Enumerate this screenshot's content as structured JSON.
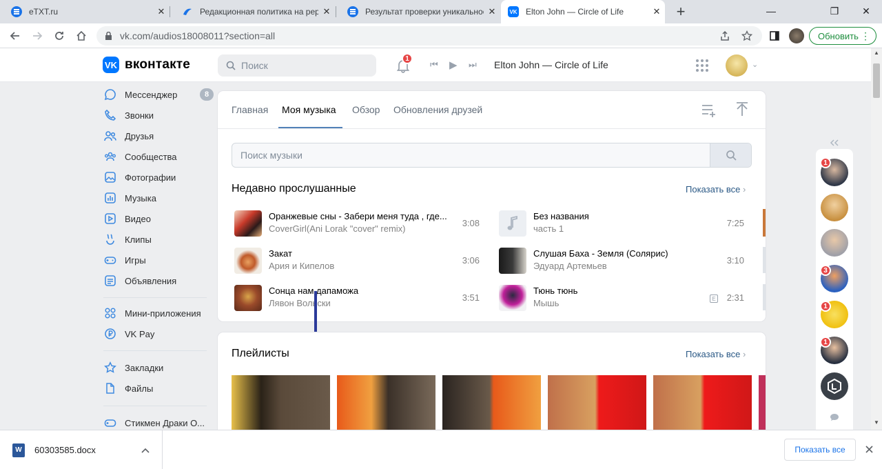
{
  "browser": {
    "tabs": [
      {
        "title": "eTXT.ru"
      },
      {
        "title": "Редакционная политика на рер"
      },
      {
        "title": "Результат проверки уникальнос"
      },
      {
        "title": "Elton John — Circle of Life"
      }
    ],
    "new_tab": "+",
    "close_glyph": "✕",
    "window_controls": {
      "minimize": "—",
      "maximize": "❐",
      "close": "✕"
    },
    "url": "vk.com/audios18008011?section=all",
    "update_label": "Обновить"
  },
  "vk": {
    "logo_text": "вконтакте",
    "logo_mark": "VK",
    "search_placeholder": "Поиск",
    "notifications_count": "1",
    "now_playing": "Elton John — Circle of Life"
  },
  "sidebar": {
    "items": [
      {
        "label": "Мессенджер",
        "icon": "chat-icon",
        "count": "8"
      },
      {
        "label": "Звонки",
        "icon": "phone-icon"
      },
      {
        "label": "Друзья",
        "icon": "friends-icon"
      },
      {
        "label": "Сообщества",
        "icon": "communities-icon"
      },
      {
        "label": "Фотографии",
        "icon": "photo-icon"
      },
      {
        "label": "Музыка",
        "icon": "music-icon"
      },
      {
        "label": "Видео",
        "icon": "video-icon"
      },
      {
        "label": "Клипы",
        "icon": "clips-icon"
      },
      {
        "label": "Игры",
        "icon": "games-icon"
      },
      {
        "label": "Объявления",
        "icon": "ads-icon"
      },
      {
        "label": "Мини-приложения",
        "icon": "apps-icon"
      },
      {
        "label": "VK Pay",
        "icon": "vkpay-icon"
      },
      {
        "label": "Закладки",
        "icon": "bookmark-icon"
      },
      {
        "label": "Файлы",
        "icon": "file-icon"
      },
      {
        "label": "Стикмен Драки О...",
        "icon": "game-controller-icon"
      }
    ]
  },
  "music": {
    "tabs": [
      "Главная",
      "Моя музыка",
      "Обзор",
      "Обновления друзей"
    ],
    "search_placeholder": "Поиск музыки",
    "recent_title": "Недавно прослушанные",
    "show_all": "Показать все",
    "recent": [
      {
        "title": "Оранжевые сны - Забери меня туда , где...",
        "artist": "CoverGirl(Ani Lorak \"cover\" remix)",
        "duration": "3:08"
      },
      {
        "title": "Без названия",
        "artist": "часть 1",
        "duration": "7:25"
      },
      {
        "title": "Закат",
        "artist": "Ария и Кипелов",
        "duration": "3:06"
      },
      {
        "title": "Слушая Баха - Земля (Солярис)",
        "artist": "Эдуард Артемьев",
        "duration": "3:10"
      },
      {
        "title": "Сонца нам дапаможа",
        "artist": "Лявон Вольски",
        "duration": "3:51"
      },
      {
        "title": "Тюнь тюнь",
        "artist": "Мышь",
        "duration": "2:31",
        "explicit": "E"
      }
    ],
    "playlists_title": "Плейлисты",
    "playlists_show_all": "Показать все"
  },
  "right_rail": {
    "badges": [
      "1",
      "3",
      "1",
      "1"
    ]
  },
  "downloads": {
    "file_name": "60303585.docx",
    "show_all": "Показать все"
  },
  "colors": {
    "vk_blue": "#0077ff",
    "link": "#2a5885",
    "badge_red": "#e64646"
  }
}
